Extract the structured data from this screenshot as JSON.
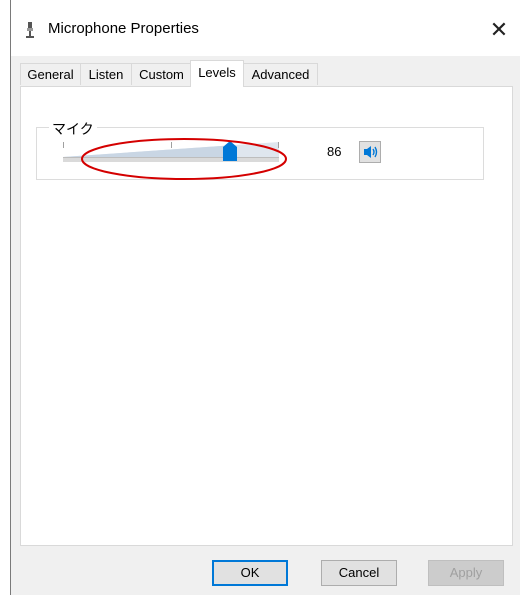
{
  "window": {
    "title": "Microphone Properties"
  },
  "tabs": [
    {
      "label": "General"
    },
    {
      "label": "Listen"
    },
    {
      "label": "Custom"
    },
    {
      "label": "Levels"
    },
    {
      "label": "Advanced"
    }
  ],
  "active_tab": "Levels",
  "levels": {
    "group_label": "マイク",
    "value": "86",
    "slider_fraction": 0.86
  },
  "buttons": {
    "ok": "OK",
    "cancel": "Cancel",
    "apply": "Apply"
  },
  "colors": {
    "accent": "#0078d7",
    "annotation": "#d40000"
  }
}
